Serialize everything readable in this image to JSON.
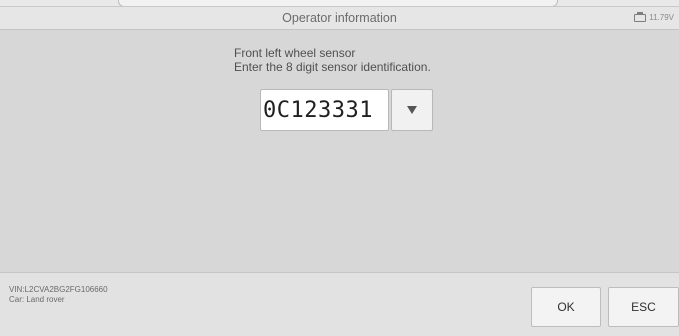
{
  "header": {
    "title": "Operator information",
    "battery_voltage": "11.79V"
  },
  "prompt": {
    "line1": "Front left wheel sensor",
    "line2": "Enter the 8 digit sensor identification."
  },
  "sensor_id": {
    "value": "0C123331"
  },
  "vehicle": {
    "vin": "VIN:L2CVA2BG2FG106660",
    "car": "Car: Land rover"
  },
  "buttons": {
    "ok_label": "OK",
    "esc_label": "ESC"
  },
  "icons": {
    "battery": "battery-icon",
    "dropdown": "chevron-down-icon"
  }
}
